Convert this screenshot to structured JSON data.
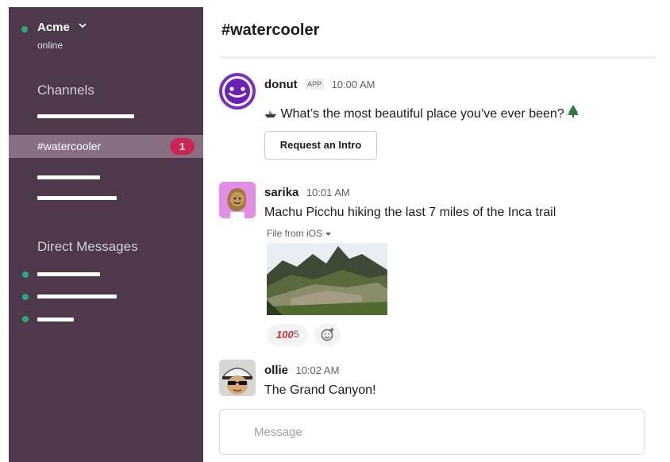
{
  "workspace": {
    "name": "Acme",
    "status": "online",
    "status_color": "#2bac76"
  },
  "sidebar": {
    "background": "#4d394b",
    "channels_heading": "Channels",
    "active_channel": {
      "label": "#watercooler",
      "unread": "1",
      "badge_color": "#cd2553"
    },
    "dm_heading": "Direct Messages",
    "presence_color": "#2bac76"
  },
  "channel": {
    "title": "#watercooler"
  },
  "messages": [
    {
      "author": "donut",
      "tag": "APP",
      "time": "10:00 AM",
      "text": "What’s the most beautiful place you’ve ever been?",
      "button": "Request an Intro",
      "icons": [
        "ship-icon",
        "tree-icon"
      ]
    },
    {
      "author": "sarika",
      "time": "10:01 AM",
      "text": "Machu Picchu hiking the last 7 miles of the Inca trail",
      "file_label": "File from iOS",
      "reaction": {
        "emoji": "100",
        "count": "5"
      }
    },
    {
      "author": "ollie",
      "time": "10:02 AM",
      "text": "The Grand Canyon!"
    }
  ],
  "composer": {
    "placeholder": "Message"
  }
}
